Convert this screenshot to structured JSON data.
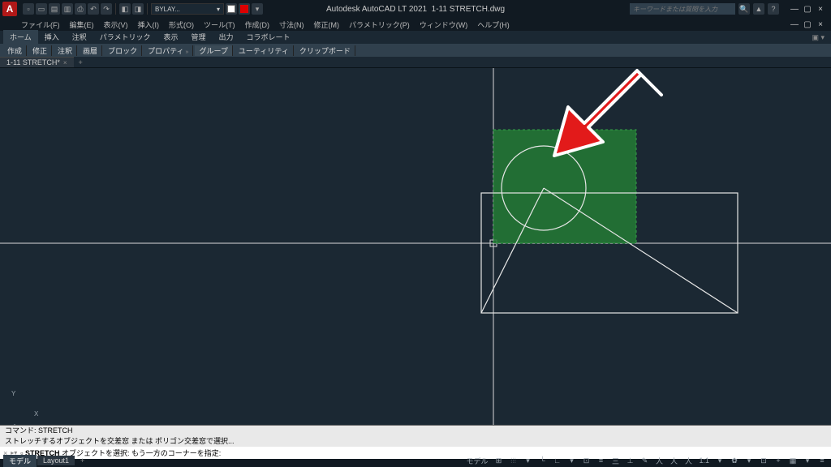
{
  "title": {
    "app": "Autodesk AutoCAD LT 2021",
    "file": "1-11 STRETCH.dwg"
  },
  "search": {
    "placeholder": "キーワードまたは質問を入力"
  },
  "qat": {
    "layer_label": "BYLAY...",
    "layer_chev": "▾"
  },
  "menubar": {
    "items": [
      "ファイル(F)",
      "編集(E)",
      "表示(V)",
      "挿入(I)",
      "形式(O)",
      "ツール(T)",
      "作成(D)",
      "寸法(N)",
      "修正(M)",
      "パラメトリック(P)",
      "ウィンドウ(W)",
      "ヘルプ(H)"
    ]
  },
  "ribbon_tabs": {
    "items": [
      "ホーム",
      "挿入",
      "注釈",
      "パラメトリック",
      "表示",
      "管理",
      "出力",
      "コラボレート"
    ],
    "chev": "▣ ▾"
  },
  "ribbon_panels": {
    "items": [
      "作成",
      "修正",
      "注釈",
      "画層",
      "ブロック",
      "プロパティ",
      "グループ",
      "ユーティリティ",
      "クリップボード"
    ],
    "sel_index": 6
  },
  "filetab": {
    "name": "1-11 STRETCH*",
    "close": "×",
    "plus": "+"
  },
  "cmd": {
    "hist1": "コマンド: STRETCH",
    "hist2": "ストレッチするオブジェクトを交差窓 または ポリゴン交差窓で選択...",
    "prompt_bold": "STRETCH",
    "prompt_rest": " オブジェクトを選択:  もう一方のコーナーを指定:",
    "x": "×",
    "chev": "▸▾"
  },
  "status": {
    "tabs": [
      "モデル",
      "Layout1"
    ],
    "plus": "+",
    "right": [
      "モデル",
      "⊞",
      "⫶⫶⫶",
      "▾",
      "└",
      "∟",
      "▾",
      "⊡",
      "≡",
      "三",
      "⊥",
      "✎",
      "人",
      "人",
      "人",
      "1:1",
      "▾",
      "✿",
      "▾",
      "⊡",
      "+",
      "▦",
      "▾",
      "≡"
    ]
  },
  "ucs": {
    "x": "X",
    "y": "Y"
  }
}
